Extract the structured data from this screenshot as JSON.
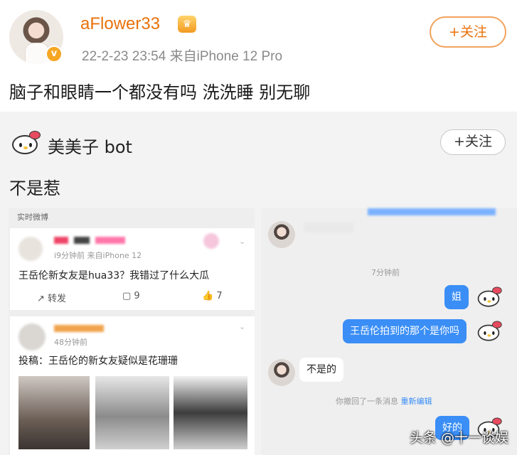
{
  "post": {
    "username": "aFlower33",
    "meta": "22-2-23 23:54  来自iPhone 12 Pro",
    "follow_label": "+关注",
    "text": "脑子和眼睛一个都没有吗 洗洗睡 别无聊"
  },
  "repost": {
    "username": "美美子 bot",
    "follow_label": "+关注",
    "text": "不是惹",
    "left_shot": {
      "header": "实时微博",
      "card1": {
        "meta": "i9分钟前  来自iPhone 12",
        "text": "王岳伦新女友是hua33？我错过了什么大瓜",
        "actions": {
          "repost": "转发",
          "comment": "9",
          "like": "7"
        }
      },
      "card2": {
        "meta": "48分钟前",
        "text": "投稿：王岳伦的新女友疑似是花珊珊"
      }
    },
    "right_shot": {
      "time": "7分钟前",
      "msg1": "姐",
      "msg2": "王岳伦拍到的那个是你吗",
      "reply": "不是的",
      "recall": "你撤回了一条消息",
      "reedit": "重新编辑",
      "msg3": "好的"
    }
  },
  "watermark": "头条 @十一谈娱"
}
